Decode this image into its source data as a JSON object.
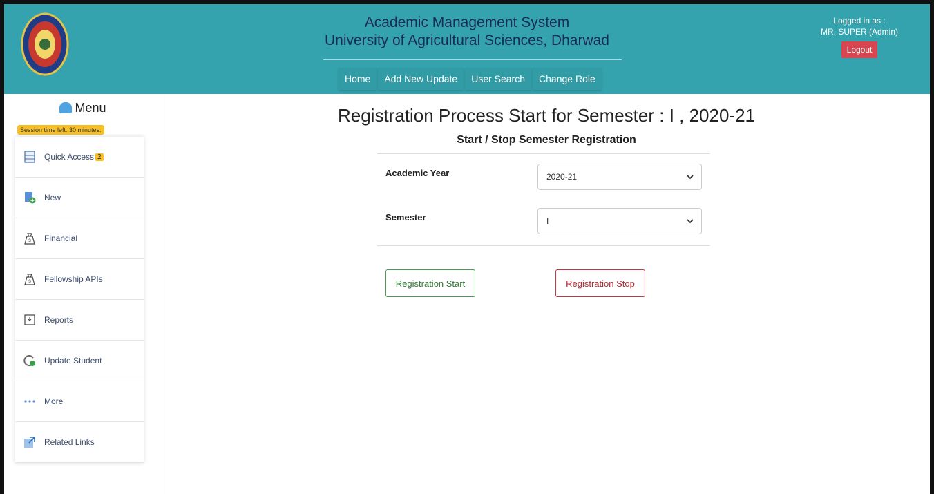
{
  "header": {
    "title_line1": "Academic Management System",
    "title_line2": "University of Agricultural Sciences, Dharwad",
    "nav": [
      "Home",
      "Add New Update",
      "User Search",
      "Change Role"
    ],
    "logged_in_label": "Logged in as :",
    "user_name": "MR. SUPER (Admin)",
    "logout_label": "Logout",
    "bg_color": "#35a3ad"
  },
  "sidebar": {
    "menu_title": "Menu",
    "session_text": "Session time left: 30 minutes.",
    "items": [
      {
        "label": "Quick Access",
        "icon": "quick-access-icon",
        "badge": "2"
      },
      {
        "label": "New",
        "icon": "new-file-icon"
      },
      {
        "label": "Financial",
        "icon": "money-bag-icon"
      },
      {
        "label": "Fellowship APIs",
        "icon": "money-bag-icon"
      },
      {
        "label": "Reports",
        "icon": "report-icon"
      },
      {
        "label": "Update Student",
        "icon": "update-icon"
      },
      {
        "label": "More",
        "icon": "more-dots-icon"
      },
      {
        "label": "Related Links",
        "icon": "external-link-icon"
      }
    ]
  },
  "main": {
    "page_title": "Registration Process Start for Semester : I , 2020-21",
    "sub_title": "Start / Stop Semester Registration",
    "academic_year_label": "Academic Year",
    "academic_year_value": "2020-21",
    "semester_label": "Semester",
    "semester_value": "I",
    "start_button": "Registration Start",
    "stop_button": "Registration Stop"
  }
}
